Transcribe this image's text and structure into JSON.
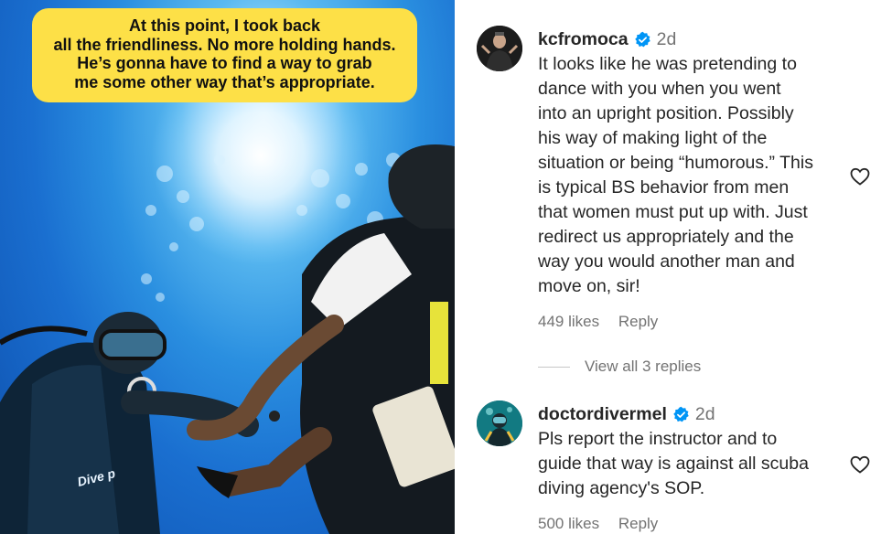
{
  "video": {
    "caption_lines": [
      "At this point, I took back",
      "all the friendliness. No more holding hands.",
      "He’s gonna have to find a way to grab",
      "me some other way that’s appropriate."
    ],
    "gear_text": "Dive p"
  },
  "comments": [
    {
      "username": "kcfromoca",
      "verified": true,
      "time": "2d",
      "lines": [
        "It looks like he was pretending to",
        "dance with you when you went",
        "into an upright position. Possibly",
        "his way of making light of the",
        "situation or being “humorous.” This",
        "is typical BS behavior from men",
        "that women must put up with. Just",
        "redirect us appropriately and the",
        "way you would another man and",
        "move on, sir!"
      ],
      "likes": "449 likes",
      "reply_label": "Reply",
      "view_replies": "View all 3 replies"
    },
    {
      "username": "doctordivermel",
      "verified": true,
      "time": "2d",
      "lines": [
        "Pls report the instructor and to",
        "guide that way is against all scuba",
        "diving agency's SOP."
      ],
      "likes": "500 likes",
      "reply_label": "Reply"
    }
  ],
  "colors": {
    "caption_bg": "#fde047",
    "verified_blue": "#0095f6",
    "text_primary": "#262626",
    "text_secondary": "#737373"
  },
  "icons": [
    "heart-icon",
    "verified-badge-icon"
  ]
}
